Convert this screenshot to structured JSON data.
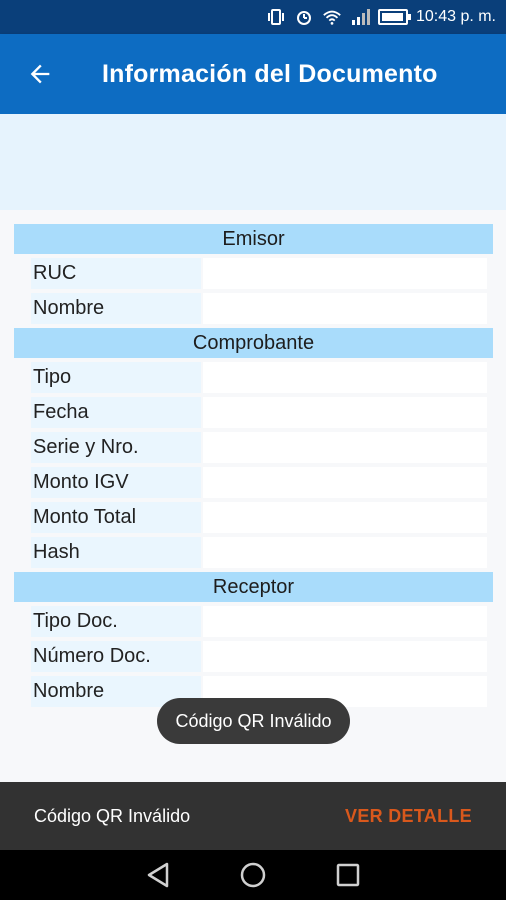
{
  "status_bar": {
    "time": "10:43 p. m.",
    "icons": [
      "vibrate-icon",
      "alarm-icon",
      "wifi-icon",
      "signal-icon",
      "battery-charging-icon"
    ]
  },
  "app_bar": {
    "title": "Información del Documento",
    "back_icon": "arrow-back-icon"
  },
  "sections": [
    {
      "title": "Emisor",
      "fields": [
        {
          "label": "RUC",
          "value": ""
        },
        {
          "label": "Nombre",
          "value": ""
        }
      ]
    },
    {
      "title": "Comprobante",
      "fields": [
        {
          "label": "Tipo",
          "value": ""
        },
        {
          "label": "Fecha",
          "value": ""
        },
        {
          "label": "Serie y Nro.",
          "value": ""
        },
        {
          "label": "Monto IGV",
          "value": ""
        },
        {
          "label": "Monto Total",
          "value": ""
        },
        {
          "label": "Hash",
          "value": ""
        }
      ]
    },
    {
      "title": "Receptor",
      "fields": [
        {
          "label": "Tipo Doc.",
          "value": ""
        },
        {
          "label": "Número Doc.",
          "value": ""
        },
        {
          "label": "Nombre",
          "value": ""
        }
      ]
    }
  ],
  "toast": {
    "text": "Código QR Inválido"
  },
  "snackbar": {
    "message": "Código QR Inválido",
    "action": "VER DETALLE"
  },
  "colors": {
    "app_bar": "#0d6cc2",
    "status_bar": "#0a3f7a",
    "section_header": "#a9dcfb",
    "snackbar_action": "#d9581c"
  }
}
